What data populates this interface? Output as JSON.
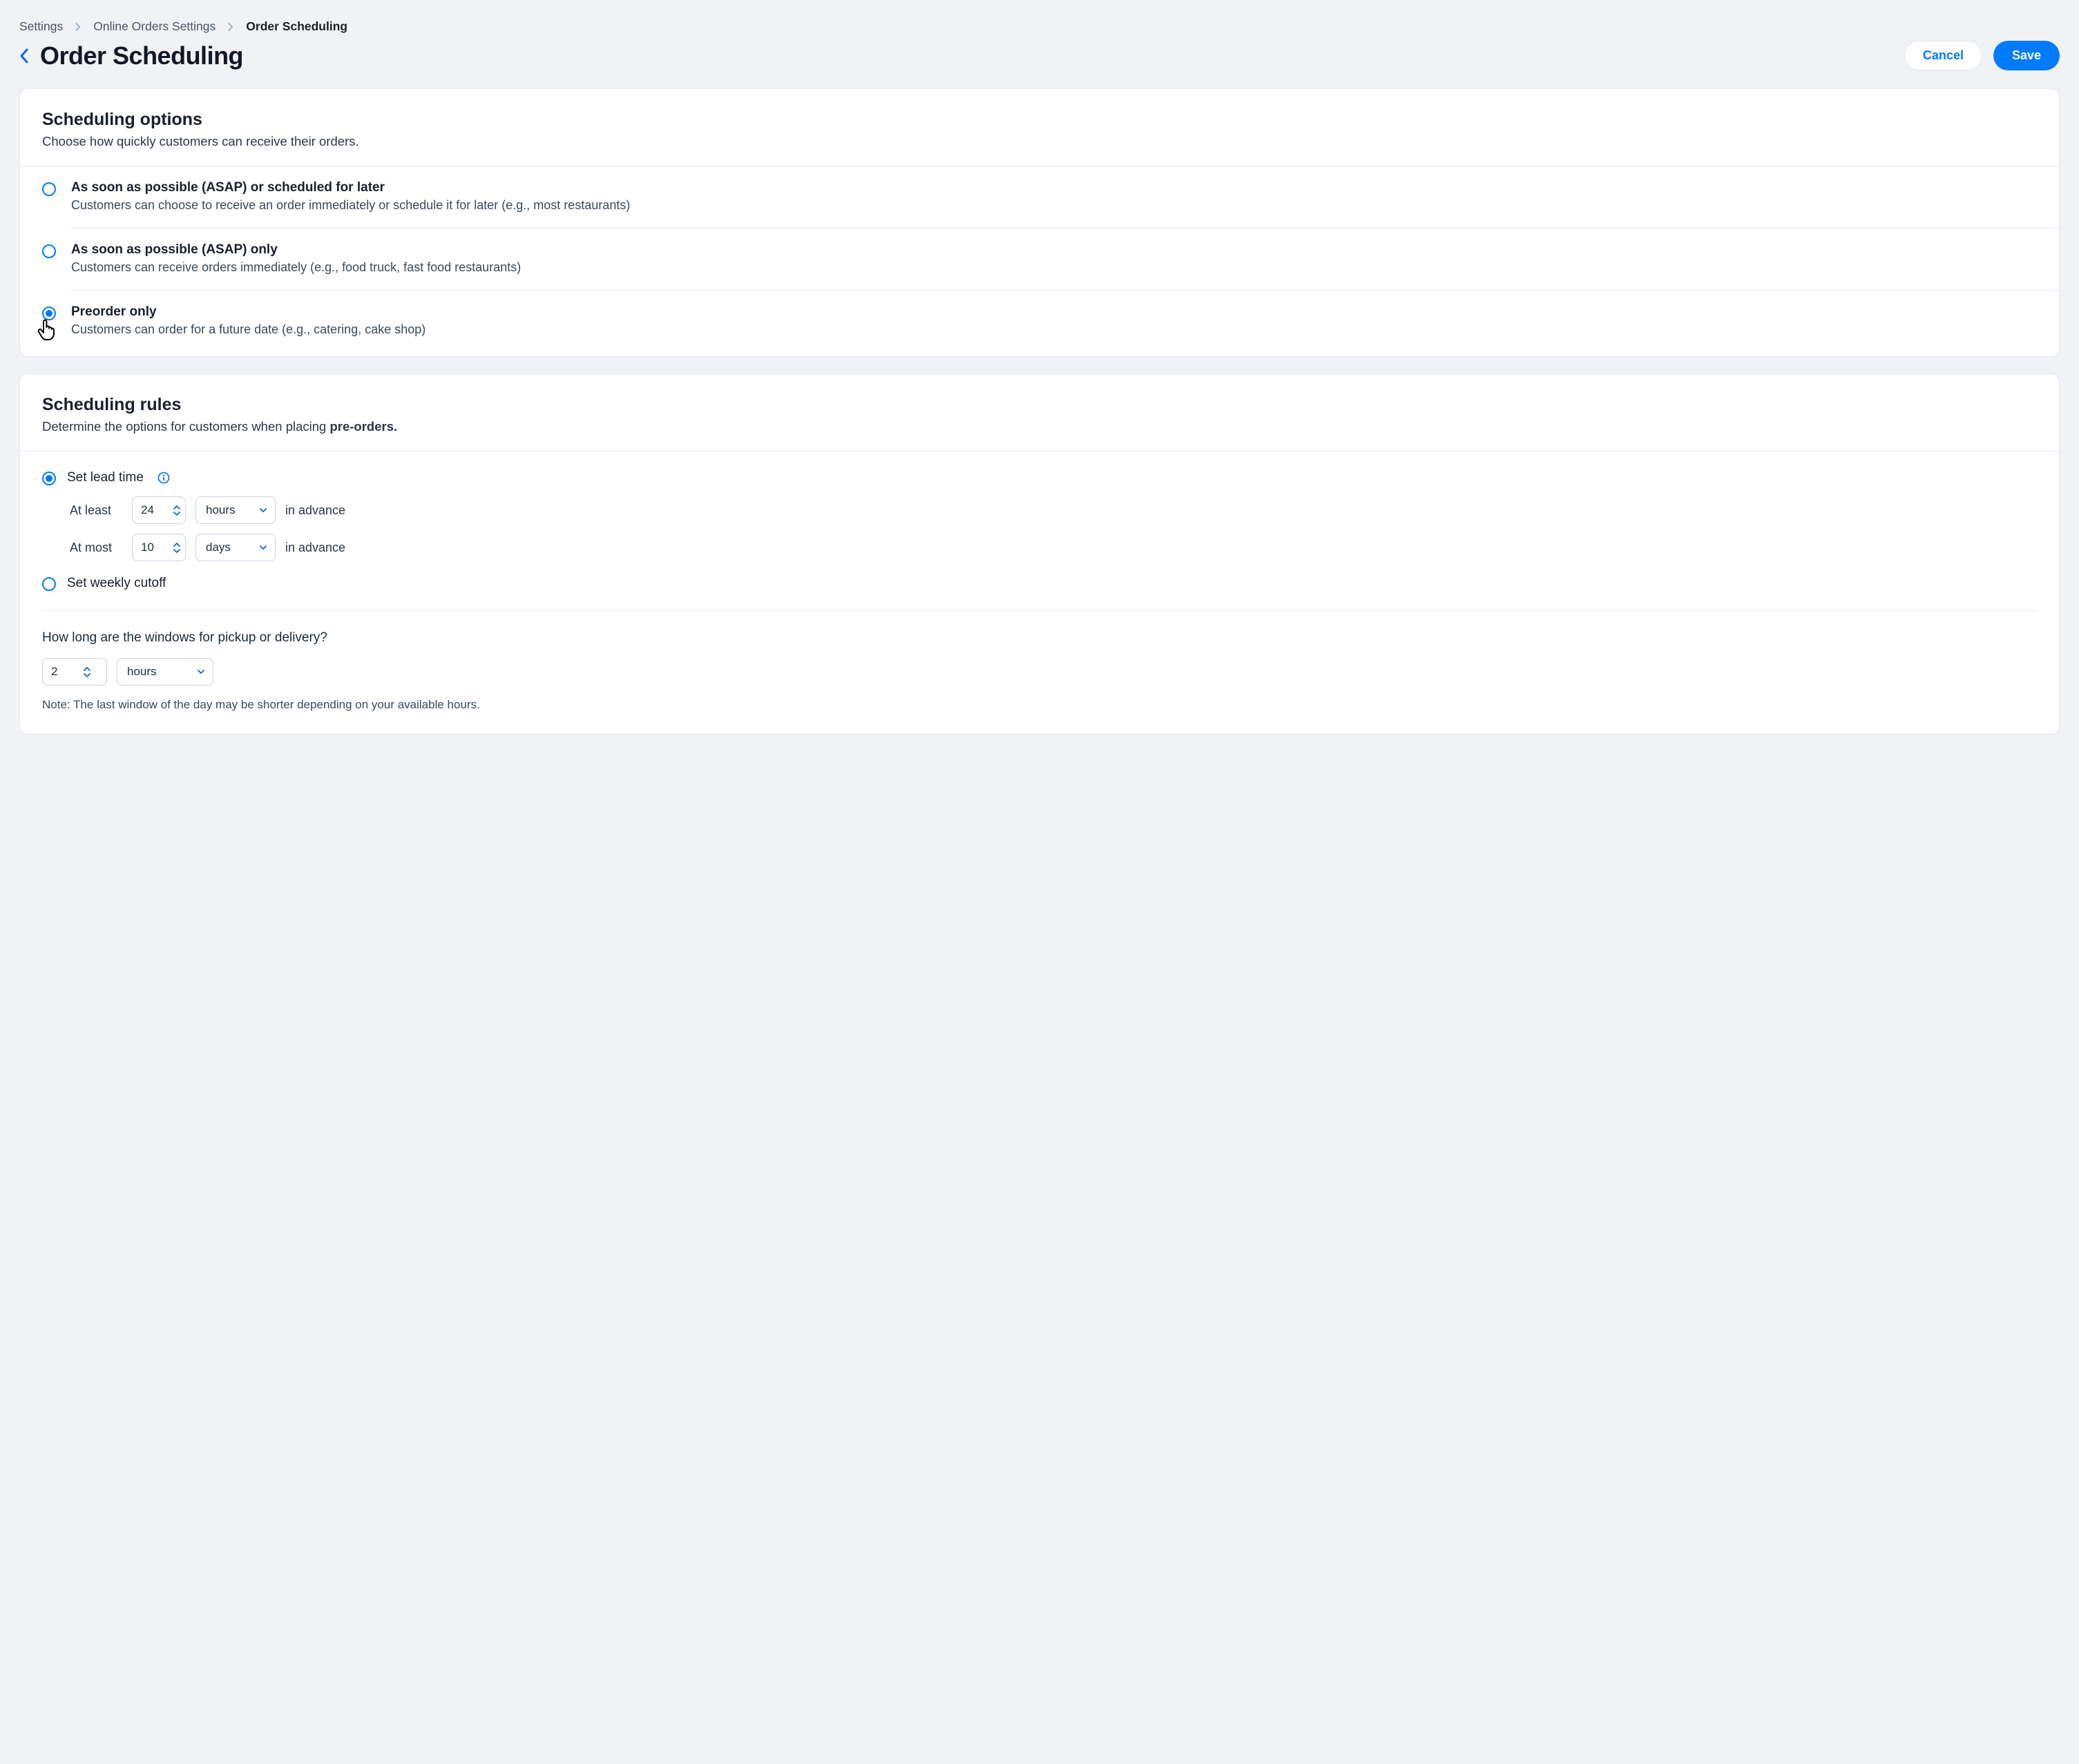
{
  "breadcrumb": {
    "settings": "Settings",
    "online_orders": "Online Orders Settings",
    "current": "Order Scheduling"
  },
  "page_title": "Order Scheduling",
  "buttons": {
    "cancel": "Cancel",
    "save": "Save"
  },
  "scheduling_options": {
    "title": "Scheduling options",
    "subtitle": "Choose how quickly customers can receive their orders.",
    "options": [
      {
        "title": "As soon as possible (ASAP) or scheduled for later",
        "desc": "Customers can choose to receive an order immediately or schedule it for later (e.g., most restaurants)",
        "selected": false
      },
      {
        "title": "As soon as possible (ASAP)  only",
        "desc": "Customers can receive orders immediately (e.g., food truck, fast food restaurants)",
        "selected": false
      },
      {
        "title": "Preorder only",
        "desc": "Customers can order for a future date (e.g., catering, cake shop)",
        "selected": true
      }
    ]
  },
  "scheduling_rules": {
    "title": "Scheduling rules",
    "subtitle_prefix": "Determine the options for customers when placing ",
    "subtitle_bold": "pre-orders.",
    "lead_time": {
      "label": "Set lead time",
      "selected": true,
      "at_least_label": "At least",
      "at_least_value": "24",
      "at_least_unit": "hours",
      "at_most_label": "At most",
      "at_most_value": "10",
      "at_most_unit": "days",
      "suffix": "in advance"
    },
    "weekly_cutoff": {
      "label": "Set weekly cutoff",
      "selected": false
    },
    "windows": {
      "question": "How long are the windows for pickup or delivery?",
      "value": "2",
      "unit": "hours",
      "note": "Note: The last window of the day may be shorter depending on your available hours."
    }
  }
}
